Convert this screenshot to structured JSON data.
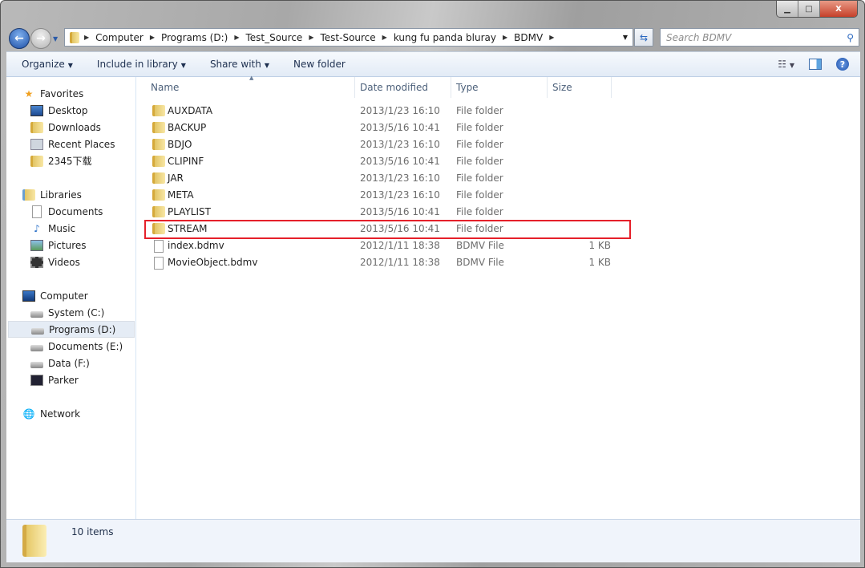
{
  "window": {
    "minimize": "▁",
    "maximize": "□",
    "close": "X"
  },
  "address": {
    "crumbs": [
      "Computer",
      "Programs (D:)",
      "Test_Source",
      "Test-Source",
      "kung fu panda bluray",
      "BDMV"
    ]
  },
  "search": {
    "placeholder": "Search BDMV"
  },
  "toolbar": {
    "organize": "Organize",
    "include": "Include in library",
    "share": "Share with",
    "new_folder": "New folder"
  },
  "sidebar": {
    "favorites": "Favorites",
    "favorites_items": [
      "Desktop",
      "Downloads",
      "Recent Places",
      "2345下载"
    ],
    "libraries": "Libraries",
    "libraries_items": [
      "Documents",
      "Music",
      "Pictures",
      "Videos"
    ],
    "computer": "Computer",
    "computer_items": [
      "System (C:)",
      "Programs (D:)",
      "Documents (E:)",
      "Data (F:)",
      "Parker"
    ],
    "network": "Network"
  },
  "columns": {
    "name": "Name",
    "date": "Date modified",
    "type": "Type",
    "size": "Size"
  },
  "files": [
    {
      "name": "AUXDATA",
      "date": "2013/1/23 16:10",
      "type": "File folder",
      "size": ""
    },
    {
      "name": "BACKUP",
      "date": "2013/5/16 10:41",
      "type": "File folder",
      "size": ""
    },
    {
      "name": "BDJO",
      "date": "2013/1/23 16:10",
      "type": "File folder",
      "size": ""
    },
    {
      "name": "CLIPINF",
      "date": "2013/5/16 10:41",
      "type": "File folder",
      "size": ""
    },
    {
      "name": "JAR",
      "date": "2013/1/23 16:10",
      "type": "File folder",
      "size": ""
    },
    {
      "name": "META",
      "date": "2013/1/23 16:10",
      "type": "File folder",
      "size": ""
    },
    {
      "name": "PLAYLIST",
      "date": "2013/5/16 10:41",
      "type": "File folder",
      "size": ""
    },
    {
      "name": "STREAM",
      "date": "2013/5/16 10:41",
      "type": "File folder",
      "size": ""
    },
    {
      "name": "index.bdmv",
      "date": "2012/1/11 18:38",
      "type": "BDMV File",
      "size": "1 KB"
    },
    {
      "name": "MovieObject.bdmv",
      "date": "2012/1/11 18:38",
      "type": "BDMV File",
      "size": "1 KB"
    }
  ],
  "status": {
    "count": "10 items"
  },
  "highlight_color": "#e5202a"
}
